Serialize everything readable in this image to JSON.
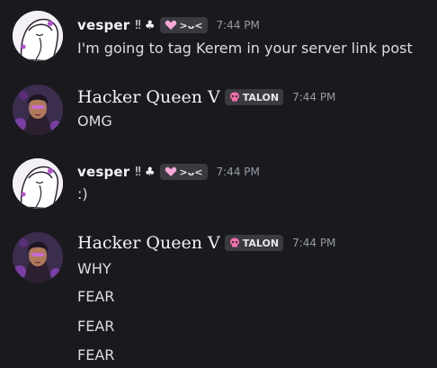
{
  "messages": [
    {
      "author": "vesper",
      "decoration": "‼ ♣",
      "tag": ">ᴗ<",
      "time": "7:44 PM",
      "lines": [
        "I'm going to tag Kerem in your server link post"
      ]
    },
    {
      "author": "Hacker Queen V",
      "tag": "TALON",
      "time": "7:44 PM",
      "lines": [
        "OMG"
      ]
    },
    {
      "author": "vesper",
      "decoration": "‼ ♣",
      "tag": ">ᴗ<",
      "time": "7:44 PM",
      "lines": [
        ":)"
      ]
    },
    {
      "author": "Hacker Queen V",
      "tag": "TALON",
      "time": "7:44 PM",
      "lines": [
        "WHY",
        "FEAR",
        "FEAR",
        "FEAR"
      ]
    }
  ],
  "colors": {
    "background": "#1a1a1e",
    "username": "#f2f3f5",
    "timestamp": "#949ba4",
    "message_text": "#dbdee1",
    "tag_background": "#3a3b41",
    "heart": "#f7a8d6",
    "skull": "#ff6fae"
  },
  "icons": {
    "vesper_tag_icon": "heart-icon",
    "queen_tag_icon": "skull-icon"
  }
}
